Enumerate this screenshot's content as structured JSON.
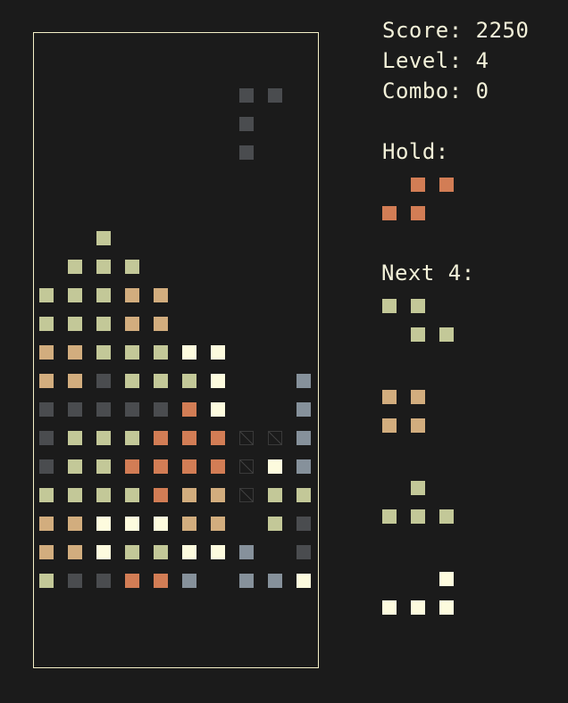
{
  "hud": {
    "score_label": "Score:",
    "score_value": "2250",
    "level_label": "Level:",
    "level_value": "4",
    "combo_label": "Combo:",
    "combo_value": "0",
    "hold_label": "Hold:",
    "next_label": "Next 4:"
  },
  "colors": {
    "background": "#1b1b1b",
    "board_border": "#f5f0c8",
    "text": "#f3f1d9",
    "block_sage": "#c3c898",
    "block_tan": "#d2ad7e",
    "block_cream": "#fdfbde",
    "block_orange": "#d27d55",
    "block_dark": "#4a4c4f",
    "block_slate": "#86919b",
    "ghost_outline": "#3a3a3a"
  },
  "board": {
    "columns": 10,
    "rows": 21,
    "active_piece": {
      "color": "block_dark",
      "cells": [
        [
          7,
          3
        ],
        [
          8,
          3
        ],
        [
          7,
          4
        ],
        [
          7,
          5
        ]
      ]
    },
    "ghost_cells": [
      [
        7,
        15
      ],
      [
        8,
        15
      ],
      [
        7,
        16
      ],
      [
        7,
        17
      ]
    ],
    "locked_rows": [
      {
        "row": 8,
        "cells": [
          [
            2,
            "block_sage"
          ]
        ]
      },
      {
        "row": 9,
        "cells": [
          [
            1,
            "block_sage"
          ],
          [
            2,
            "block_sage"
          ],
          [
            3,
            "block_sage"
          ]
        ]
      },
      {
        "row": 10,
        "cells": [
          [
            0,
            "block_sage"
          ],
          [
            1,
            "block_sage"
          ],
          [
            2,
            "block_sage"
          ],
          [
            3,
            "block_tan"
          ],
          [
            4,
            "block_tan"
          ]
        ]
      },
      {
        "row": 11,
        "cells": [
          [
            0,
            "block_sage"
          ],
          [
            1,
            "block_sage"
          ],
          [
            2,
            "block_sage"
          ],
          [
            3,
            "block_tan"
          ],
          [
            4,
            "block_tan"
          ]
        ]
      },
      {
        "row": 12,
        "cells": [
          [
            0,
            "block_tan"
          ],
          [
            1,
            "block_tan"
          ],
          [
            2,
            "block_sage"
          ],
          [
            3,
            "block_sage"
          ],
          [
            4,
            "block_sage"
          ],
          [
            5,
            "block_cream"
          ],
          [
            6,
            "block_cream"
          ]
        ]
      },
      {
        "row": 13,
        "cells": [
          [
            0,
            "block_tan"
          ],
          [
            1,
            "block_tan"
          ],
          [
            2,
            "block_dark"
          ],
          [
            3,
            "block_sage"
          ],
          [
            4,
            "block_sage"
          ],
          [
            5,
            "block_sage"
          ],
          [
            6,
            "block_cream"
          ],
          [
            9,
            "block_slate"
          ]
        ]
      },
      {
        "row": 14,
        "cells": [
          [
            0,
            "block_dark"
          ],
          [
            1,
            "block_dark"
          ],
          [
            2,
            "block_dark"
          ],
          [
            3,
            "block_dark"
          ],
          [
            4,
            "block_dark"
          ],
          [
            5,
            "block_orange"
          ],
          [
            6,
            "block_cream"
          ],
          [
            9,
            "block_slate"
          ]
        ]
      },
      {
        "row": 15,
        "cells": [
          [
            0,
            "block_dark"
          ],
          [
            1,
            "block_sage"
          ],
          [
            2,
            "block_sage"
          ],
          [
            3,
            "block_sage"
          ],
          [
            4,
            "block_orange"
          ],
          [
            5,
            "block_orange"
          ],
          [
            6,
            "block_orange"
          ],
          [
            9,
            "block_slate"
          ]
        ]
      },
      {
        "row": 16,
        "cells": [
          [
            0,
            "block_dark"
          ],
          [
            1,
            "block_sage"
          ],
          [
            2,
            "block_sage"
          ],
          [
            3,
            "block_orange"
          ],
          [
            4,
            "block_orange"
          ],
          [
            5,
            "block_orange"
          ],
          [
            6,
            "block_orange"
          ],
          [
            8,
            "block_cream"
          ],
          [
            9,
            "block_slate"
          ]
        ]
      },
      {
        "row": 17,
        "cells": [
          [
            0,
            "block_sage"
          ],
          [
            1,
            "block_sage"
          ],
          [
            2,
            "block_sage"
          ],
          [
            3,
            "block_sage"
          ],
          [
            4,
            "block_orange"
          ],
          [
            5,
            "block_tan"
          ],
          [
            6,
            "block_tan"
          ],
          [
            8,
            "block_sage"
          ],
          [
            9,
            "block_sage"
          ]
        ]
      },
      {
        "row": 18,
        "cells": [
          [
            0,
            "block_tan"
          ],
          [
            1,
            "block_tan"
          ],
          [
            2,
            "block_cream"
          ],
          [
            3,
            "block_cream"
          ],
          [
            4,
            "block_cream"
          ],
          [
            5,
            "block_tan"
          ],
          [
            6,
            "block_tan"
          ],
          [
            8,
            "block_sage"
          ],
          [
            9,
            "block_dark"
          ]
        ]
      },
      {
        "row": 19,
        "cells": [
          [
            0,
            "block_tan"
          ],
          [
            1,
            "block_tan"
          ],
          [
            2,
            "block_cream"
          ],
          [
            3,
            "block_sage"
          ],
          [
            4,
            "block_sage"
          ],
          [
            5,
            "block_cream"
          ],
          [
            6,
            "block_cream"
          ],
          [
            7,
            "block_slate"
          ],
          [
            9,
            "block_dark"
          ]
        ]
      },
      {
        "row": 20,
        "cells": [
          [
            0,
            "block_sage"
          ],
          [
            1,
            "block_dark"
          ],
          [
            2,
            "block_dark"
          ],
          [
            3,
            "block_orange"
          ],
          [
            4,
            "block_orange"
          ],
          [
            5,
            "block_slate"
          ],
          [
            7,
            "block_slate"
          ],
          [
            8,
            "block_slate"
          ],
          [
            9,
            "block_cream"
          ]
        ]
      }
    ]
  },
  "hold_piece": {
    "shape": "S",
    "color": "block_orange",
    "cells": [
      [
        1,
        0
      ],
      [
        2,
        0
      ],
      [
        0,
        1
      ],
      [
        1,
        1
      ]
    ]
  },
  "next_pieces": [
    {
      "shape": "Z",
      "color": "block_sage",
      "cells": [
        [
          0,
          0
        ],
        [
          1,
          0
        ],
        [
          1,
          1
        ],
        [
          2,
          1
        ]
      ]
    },
    {
      "shape": "O",
      "color": "block_tan",
      "cells": [
        [
          0,
          0
        ],
        [
          1,
          0
        ],
        [
          0,
          1
        ],
        [
          1,
          1
        ]
      ]
    },
    {
      "shape": "T",
      "color": "block_sage",
      "cells": [
        [
          1,
          0
        ],
        [
          0,
          1
        ],
        [
          1,
          1
        ],
        [
          2,
          1
        ]
      ]
    },
    {
      "shape": "L",
      "color": "block_cream",
      "cells": [
        [
          2,
          0
        ],
        [
          0,
          1
        ],
        [
          1,
          1
        ],
        [
          2,
          1
        ]
      ]
    }
  ]
}
